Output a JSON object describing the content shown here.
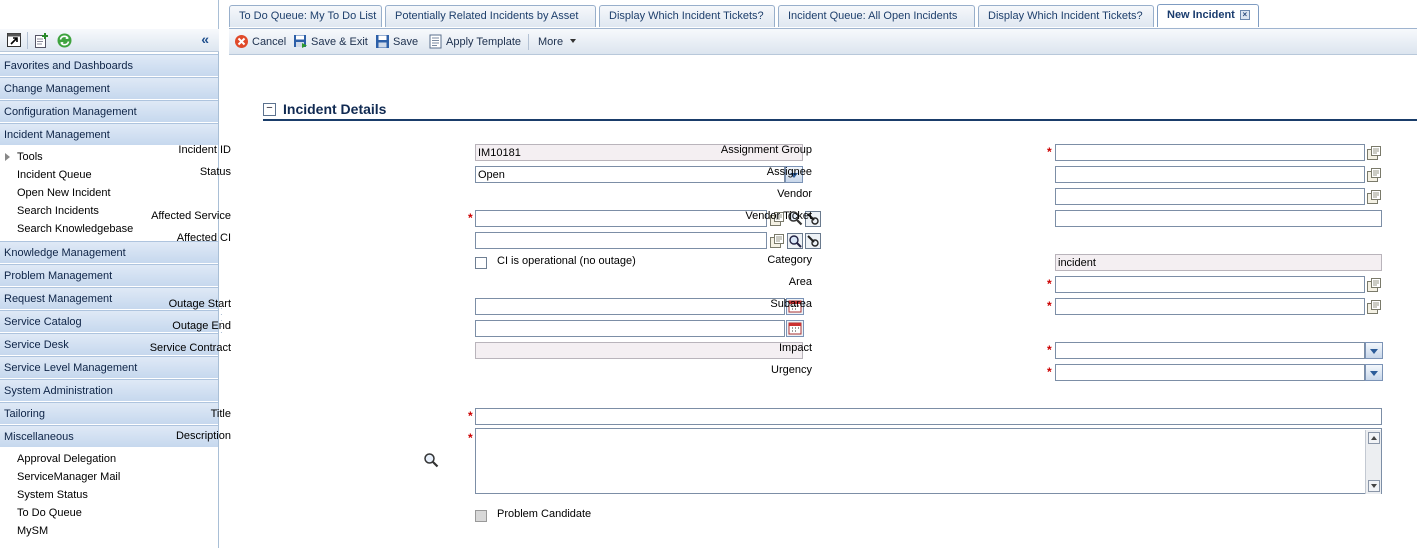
{
  "sidebar": {
    "collapse_label": "«",
    "sections": [
      {
        "label": "Favorites and Dashboards"
      },
      {
        "label": "Change Management"
      },
      {
        "label": "Configuration Management"
      },
      {
        "label": "Incident Management",
        "items": [
          "Tools",
          "Incident Queue",
          "Open New Incident",
          "Search Incidents",
          "Search Knowledgebase"
        ]
      },
      {
        "label": "Knowledge Management"
      },
      {
        "label": "Problem Management"
      },
      {
        "label": "Request Management"
      },
      {
        "label": "Service Catalog"
      },
      {
        "label": "Service Desk"
      },
      {
        "label": "Service Level Management"
      },
      {
        "label": "System Administration"
      },
      {
        "label": "Tailoring"
      },
      {
        "label": "Miscellaneous",
        "items": [
          "Approval Delegation",
          "ServiceManager Mail",
          "System Status",
          "To Do Queue",
          "MySM"
        ]
      }
    ]
  },
  "tabs": [
    {
      "label": "To Do Queue: My To Do List"
    },
    {
      "label": "Potentially Related Incidents by Asset"
    },
    {
      "label": "Display Which Incident Tickets?"
    },
    {
      "label": "Incident Queue: All Open Incidents"
    },
    {
      "label": "Display Which Incident Tickets?"
    },
    {
      "label": "New Incident",
      "active": true
    }
  ],
  "toolbar": {
    "cancel": "Cancel",
    "save_exit": "Save & Exit",
    "save": "Save",
    "apply_template": "Apply Template",
    "more": "More"
  },
  "form": {
    "section_title": "Incident Details",
    "labels": {
      "incident_id": "Incident ID",
      "status": "Status",
      "affected_service": "Affected Service",
      "affected_ci": "Affected CI",
      "ci_operational": "CI is operational (no outage)",
      "outage_start": "Outage Start",
      "outage_end": "Outage End",
      "service_contract": "Service Contract",
      "title": "Title",
      "description": "Description",
      "problem_candidate": "Problem Candidate",
      "assignment_group": "Assignment Group",
      "assignee": "Assignee",
      "vendor": "Vendor",
      "vendor_ticket": "Vendor Ticket",
      "category": "Category",
      "area": "Area",
      "subarea": "Subarea",
      "impact": "Impact",
      "urgency": "Urgency"
    },
    "values": {
      "incident_id": "IM10181",
      "status": "Open",
      "category": "incident"
    },
    "required_mark": "*"
  },
  "colors": {
    "nav_section_text": "#0e2447",
    "section_title": "#102a52",
    "required": "#cc0000",
    "readonly_bg": "#f4eff2"
  }
}
